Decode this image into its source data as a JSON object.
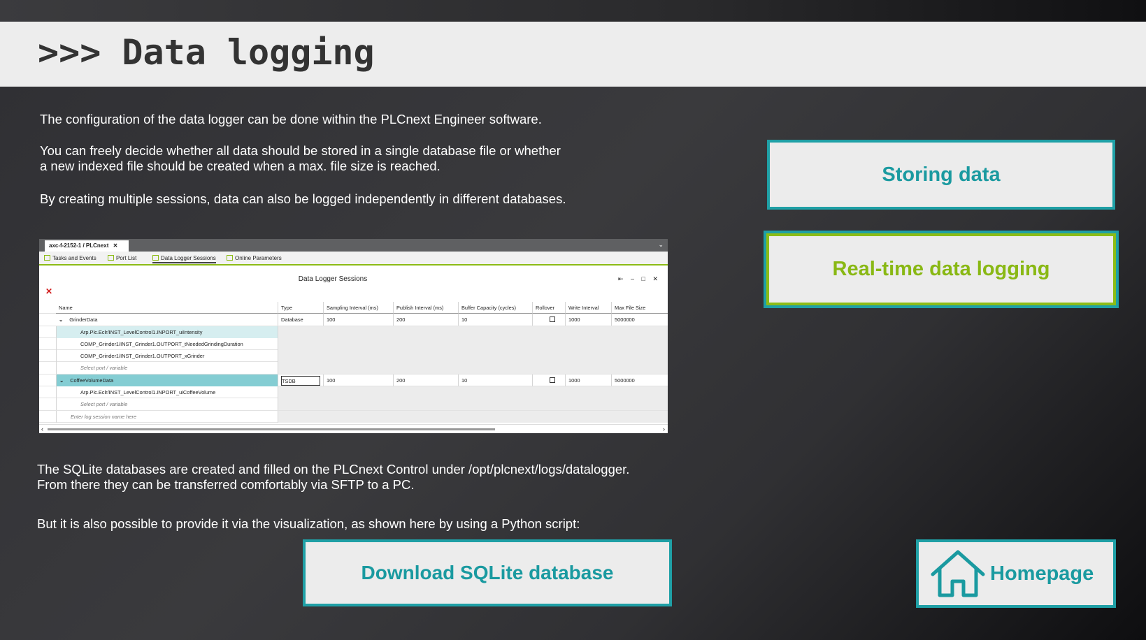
{
  "header": {
    "title": ">>> Data logging"
  },
  "intro": {
    "p1": "The configuration of the data logger can be done within the PLCnext Engineer software.",
    "p2": "You can freely decide whether all data should be stored in a single database file or whether\na new indexed file should be created when a max. file size is reached.",
    "p3": "By creating multiple sessions, data can also be logged independently in different databases."
  },
  "outro": {
    "p4": "The SQLite databases are created and filled on the PLCnext Control under /opt/plcnext/logs/datalogger.\nFrom there they can be transferred comfortably via SFTP to a PC.",
    "p5": "But it is also possible to provide it via the visualization, as shown here by using a Python script:"
  },
  "buttons": {
    "storing": "Storing data",
    "realtime": "Real-time data logging",
    "download": "Download SQLite database",
    "home": "Homepage"
  },
  "colors": {
    "teal": "#1fa0a6",
    "green": "#8cbc16",
    "band": "#ededed"
  },
  "screenshot": {
    "doc_tab": "axc-f-2152-1 / PLCnext",
    "doc_tab_close": "✕",
    "tool_tabs": [
      "Tasks and Events",
      "Port List",
      "Data Logger Sessions",
      "Online Parameters"
    ],
    "panel_title": "Data Logger Sessions",
    "panel_controls": "⇤ – □ ✕",
    "columns": [
      "Name",
      "Type",
      "Sampling Interval (ms)",
      "Publish Interval (ms)",
      "Buffer Capacity (cycles)",
      "Rollover",
      "Write Interval",
      "Max File Size"
    ],
    "rows": [
      {
        "name": "GrinderData",
        "type": "Database",
        "sampling": "100",
        "publish": "200",
        "buffer": "10",
        "write": "1000",
        "maxsize": "5000000"
      },
      {
        "name": "Arp.Plc.Eclr/INST_LevelControl1.INPORT_uiIntensity"
      },
      {
        "name": "COMP_Grinder1/INST_Grinder1.OUTPORT_tNeededGrindingDuration"
      },
      {
        "name": "COMP_Grinder1/INST_Grinder1.OUTPORT_xGrinder"
      },
      {
        "name": "Select port / variable"
      },
      {
        "name": "CoffeeVolumeData",
        "type": "TSDB",
        "sampling": "100",
        "publish": "200",
        "buffer": "10",
        "write": "1000",
        "maxsize": "5000000"
      },
      {
        "name": "Arp.Plc.Eclr/INST_LevelControl1.INPORT_uiCoffeeVolume"
      },
      {
        "name": "Select port / variable"
      },
      {
        "name": "Enter log session name here"
      }
    ]
  }
}
